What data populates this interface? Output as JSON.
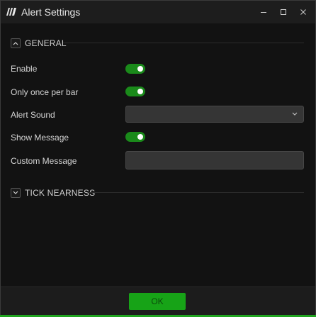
{
  "window": {
    "title": "Alert Settings",
    "logo_icon": "app-logo-icon",
    "controls": [
      "minimize-icon",
      "maximize-icon",
      "close-icon"
    ]
  },
  "sections": {
    "general": {
      "label": "GENERAL",
      "expanded": true,
      "icon": "chevron-up-icon"
    },
    "tick_nearness": {
      "label": "TICK NEARNESS",
      "expanded": false,
      "icon": "chevron-down-icon"
    }
  },
  "fields": {
    "enable": {
      "label": "Enable",
      "on": true
    },
    "only_once": {
      "label": "Only once per bar",
      "on": true
    },
    "alert_sound": {
      "label": "Alert Sound",
      "value": ""
    },
    "show_message": {
      "label": "Show Message",
      "on": true
    },
    "custom_message": {
      "label": "Custom Message",
      "value": ""
    }
  },
  "footer": {
    "ok_label": "OK"
  },
  "colors": {
    "accent": "#17a317",
    "toggle_on": "#1a8a1a",
    "background": "#121212",
    "titlebar": "#1d1d1d",
    "input_bg": "#353535"
  }
}
